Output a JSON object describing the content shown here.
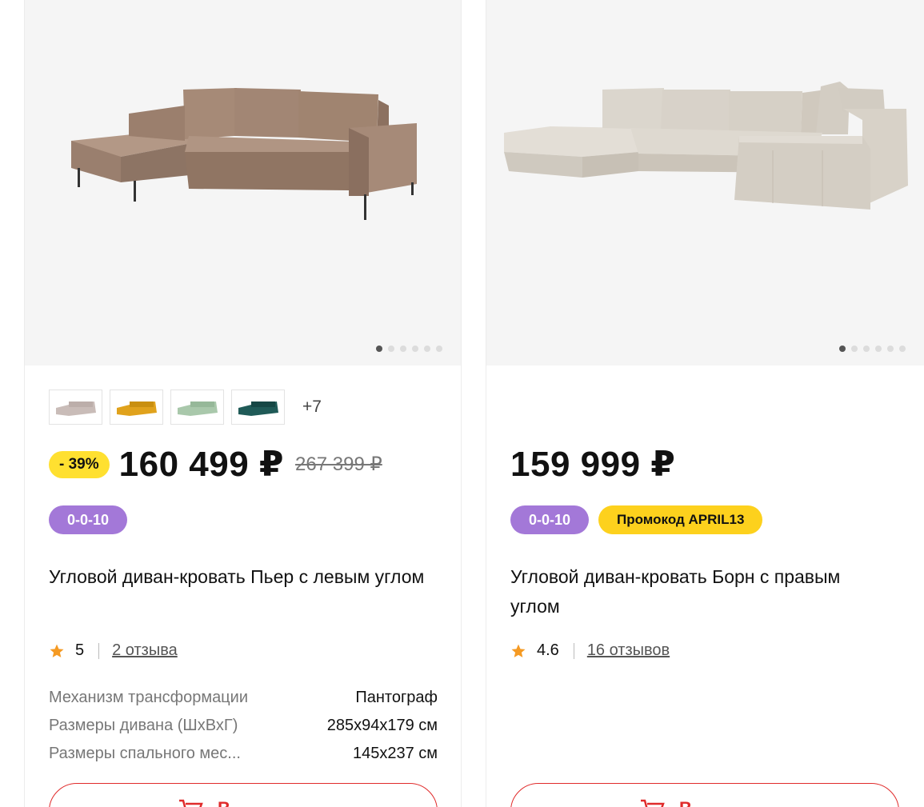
{
  "products": [
    {
      "discount": "- 39%",
      "price": "160 499 ₽",
      "old_price": "267 399 ₽",
      "more_colors": "+7",
      "badges": [
        "0-0-10"
      ],
      "title": "Угловой диван-кровать Пьер с левым углом",
      "rating": "5",
      "reviews": "2 отзыва",
      "specs": [
        {
          "label": "Механизм трансформации",
          "value": "Пантограф"
        },
        {
          "label": "Размеры дивана (ШхВхГ)",
          "value": "285x94x179 см"
        },
        {
          "label": "Размеры спального мес...",
          "value": "145x237 см"
        }
      ],
      "cart_label": "В"
    },
    {
      "price": "159 999 ₽",
      "badges": [
        "0-0-10",
        "Промокод APRIL13"
      ],
      "title": "Угловой диван-кровать Борн с правым углом",
      "rating": "4.6",
      "reviews": "16 отзывов",
      "cart_label": "В"
    }
  ],
  "colors": {
    "accent_red": "#e02b2b",
    "badge_purple": "#a378d8",
    "badge_yellow": "#fdd11d",
    "discount_yellow": "#ffe030",
    "star_orange": "#f59a23",
    "sofa_brown": "#a08672",
    "sofa_beige": "#d8d2c8"
  }
}
